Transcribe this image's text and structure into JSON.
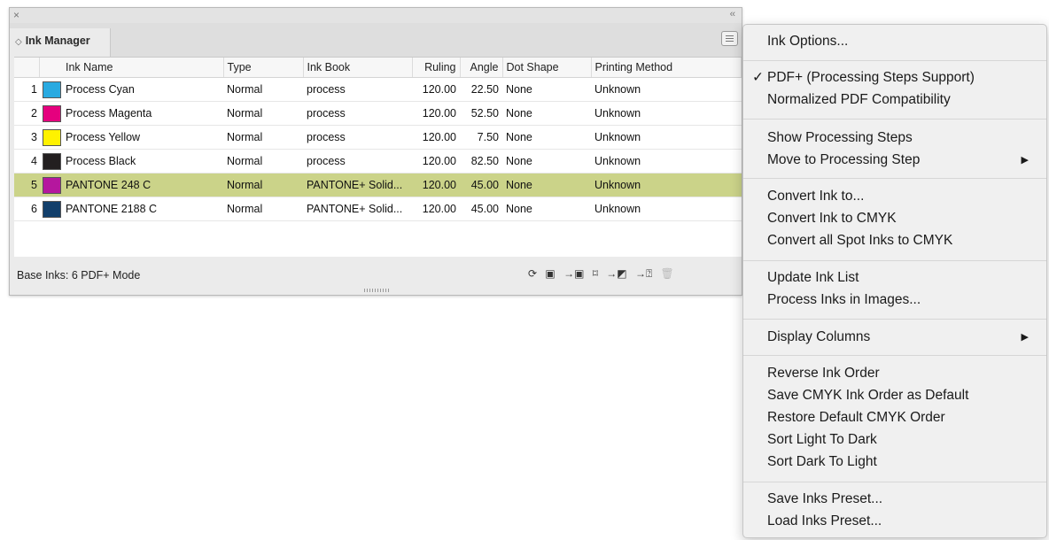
{
  "panel": {
    "close_glyph": "×",
    "collapse_glyph": "‹‹",
    "tab_label": "Ink Manager",
    "columns": [
      "Ink Name",
      "Type",
      "Ink Book",
      "Ruling",
      "Angle",
      "Dot Shape",
      "Printing Method"
    ],
    "rows": [
      {
        "index": "1",
        "color": "#29aae1",
        "name": "Process Cyan",
        "type": "Normal",
        "book": "process",
        "ruling": "120.00",
        "angle": "22.50",
        "dot": "None",
        "method": "Unknown"
      },
      {
        "index": "2",
        "color": "#e5007e",
        "name": "Process Magenta",
        "type": "Normal",
        "book": "process",
        "ruling": "120.00",
        "angle": "52.50",
        "dot": "None",
        "method": "Unknown"
      },
      {
        "index": "3",
        "color": "#fff200",
        "name": "Process Yellow",
        "type": "Normal",
        "book": "process",
        "ruling": "120.00",
        "angle": "7.50",
        "dot": "None",
        "method": "Unknown"
      },
      {
        "index": "4",
        "color": "#231f20",
        "name": "Process Black",
        "type": "Normal",
        "book": "process",
        "ruling": "120.00",
        "angle": "82.50",
        "dot": "None",
        "method": "Unknown"
      },
      {
        "index": "5",
        "color": "#b5179e",
        "name": "PANTONE 248 C",
        "type": "Normal",
        "book": "PANTONE+ Solid...",
        "ruling": "120.00",
        "angle": "45.00",
        "dot": "None",
        "method": "Unknown",
        "selected": true
      },
      {
        "index": "6",
        "color": "#123f6b",
        "name": "PANTONE 2188 C",
        "type": "Normal",
        "book": "PANTONE+ Solid...",
        "ruling": "120.00",
        "angle": "45.00",
        "dot": "None",
        "method": "Unknown"
      }
    ],
    "status_text": "Base Inks: 6   PDF+ Mode",
    "selected_color": "#cbd389"
  },
  "menu": {
    "ink_options": "Ink Options...",
    "pdf_plus": "PDF+ (Processing Steps Support)",
    "pdf_plus_checked": "✓",
    "normalized_pdf": "Normalized PDF Compatibility",
    "show_steps": "Show Processing Steps",
    "move_step": "Move to Processing Step",
    "convert_ink": "Convert Ink to...",
    "convert_cmyk": "Convert Ink to CMYK",
    "convert_all": "Convert all Spot Inks to CMYK",
    "update_list": "Update Ink List",
    "process_images": "Process Inks in Images...",
    "display_columns": "Display Columns",
    "reverse_order": "Reverse Ink Order",
    "save_cmyk_default": "Save CMYK Ink Order as Default",
    "restore_cmyk": "Restore Default CMYK Order",
    "sort_light_dark": "Sort Light To Dark",
    "sort_dark_light": "Sort Dark To Light",
    "save_preset": "Save Inks Preset...",
    "load_preset": "Load Inks Preset...",
    "submenu_arrow": "▶"
  }
}
